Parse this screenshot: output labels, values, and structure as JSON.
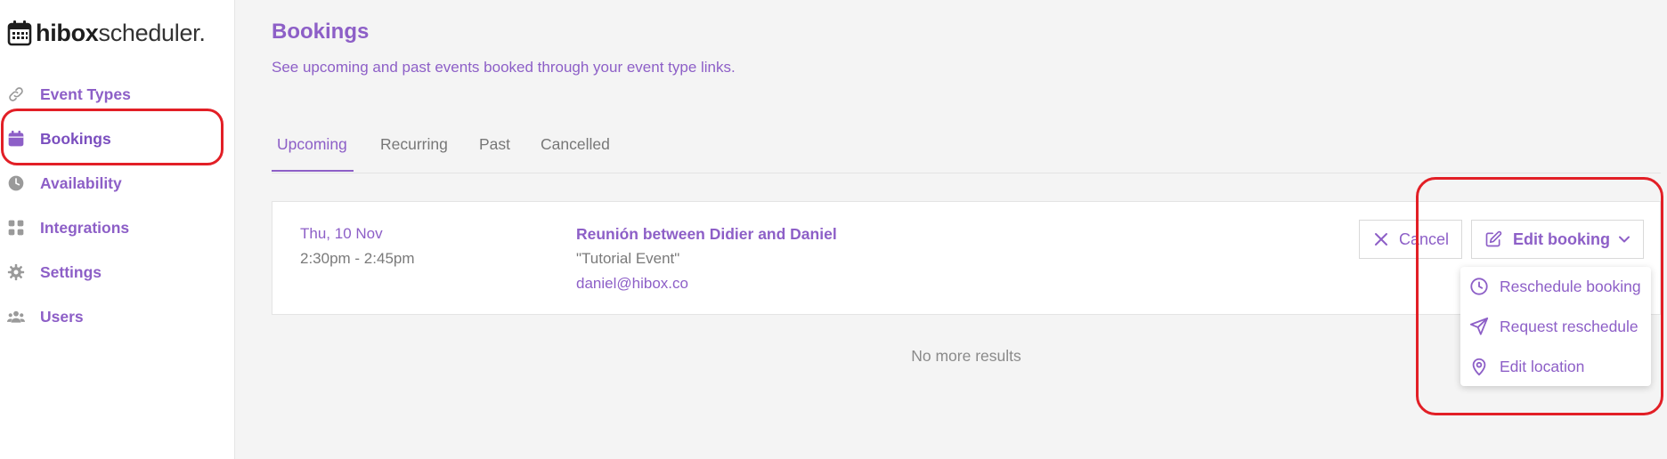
{
  "app": {
    "logo_bold": "hibox",
    "logo_light": "scheduler."
  },
  "sidebar": {
    "items": [
      {
        "label": "Event Types",
        "icon": "link-icon"
      },
      {
        "label": "Bookings",
        "icon": "calendar-icon",
        "active": true
      },
      {
        "label": "Availability",
        "icon": "clock-icon"
      },
      {
        "label": "Integrations",
        "icon": "grid-icon"
      },
      {
        "label": "Settings",
        "icon": "gear-icon"
      },
      {
        "label": "Users",
        "icon": "users-icon"
      }
    ]
  },
  "page": {
    "title": "Bookings",
    "subtitle": "See upcoming and past events booked through your event type links."
  },
  "tabs": [
    {
      "label": "Upcoming",
      "active": true
    },
    {
      "label": "Recurring"
    },
    {
      "label": "Past"
    },
    {
      "label": "Cancelled"
    }
  ],
  "booking": {
    "date": "Thu, 10 Nov",
    "time": "2:30pm - 2:45pm",
    "title": "Reunión between Didier and Daniel",
    "event": "\"Tutorial Event\"",
    "email": "daniel@hibox.co",
    "cancel_label": "Cancel",
    "edit_label": "Edit booking"
  },
  "dropdown": {
    "items": [
      {
        "label": "Reschedule booking",
        "icon": "clock-icon"
      },
      {
        "label": "Request reschedule",
        "icon": "send-icon"
      },
      {
        "label": "Edit location",
        "icon": "map-pin-icon"
      }
    ]
  },
  "footer": {
    "no_more": "No more results"
  },
  "colors": {
    "accent": "#8d5fc7",
    "annotation": "#e21f26",
    "background": "#f4f4f4"
  }
}
